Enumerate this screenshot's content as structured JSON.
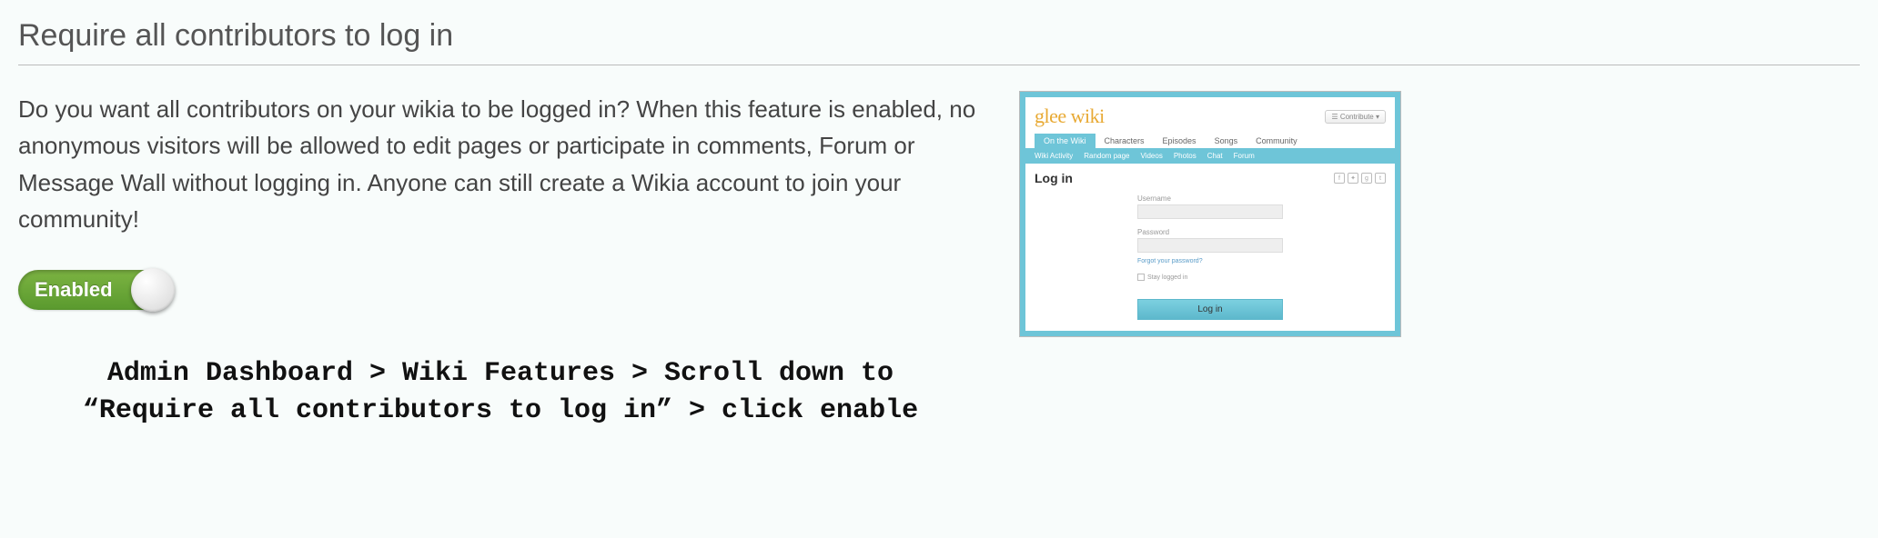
{
  "section": {
    "title": "Require all contributors to log in",
    "description": "Do you want all contributors on your wikia to be logged in? When this feature is enabled, no anonymous visitors will be allowed to edit pages or participate in comments, Forum or Message Wall without logging in. Anyone can still create a Wikia account to join your community!"
  },
  "toggle": {
    "label": "Enabled"
  },
  "instruction": {
    "line1": "Admin Dashboard > Wiki Features > Scroll down to",
    "line2": "“Require all contributors to log in” > click enable"
  },
  "thumbnail": {
    "logo": "glee wiki",
    "contribute": "Contribute",
    "tabs_primary": [
      "On the Wiki",
      "Characters",
      "Episodes",
      "Songs",
      "Community"
    ],
    "tabs_secondary": [
      "Wiki Activity",
      "Random page",
      "Videos",
      "Photos",
      "Chat",
      "Forum"
    ],
    "login": {
      "title": "Log in",
      "username_label": "Username",
      "password_label": "Password",
      "forgot": "Forgot your password?",
      "stay": "Stay logged in",
      "button": "Log in"
    }
  }
}
